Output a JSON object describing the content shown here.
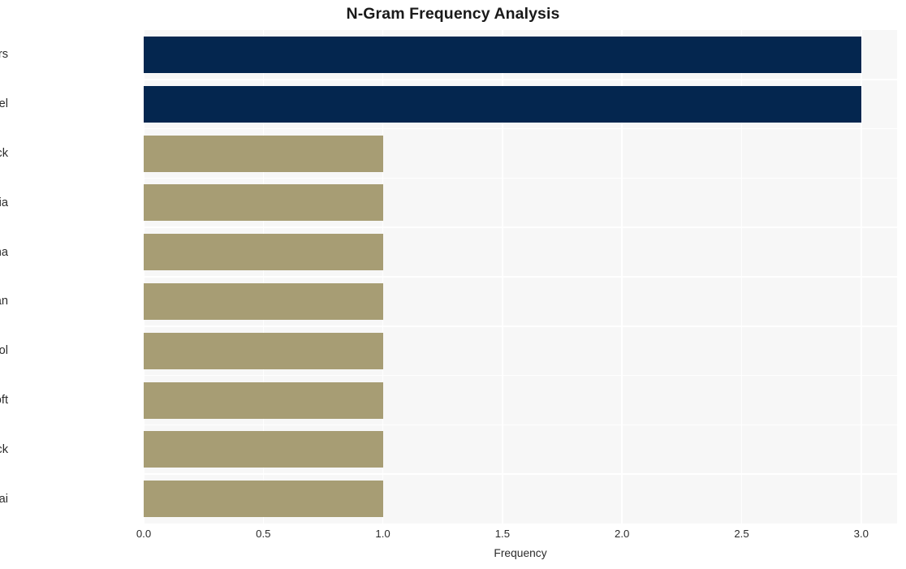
{
  "chart_data": {
    "type": "bar",
    "orientation": "horizontal",
    "title": "N-Gram Frequency Analysis",
    "xlabel": "Frequency",
    "ylabel": "",
    "categories": [
      "state back hackers",
      "large language model",
      "hash state back",
      "back hackers russia",
      "hackers russia china",
      "russia china iran",
      "china iran tool",
      "iran tool microsoft",
      "tool microsoft back",
      "microsoft back openai"
    ],
    "values": [
      3,
      3,
      1,
      1,
      1,
      1,
      1,
      1,
      1,
      1
    ],
    "bar_colors": [
      "#04264f",
      "#04264f",
      "#a79d74",
      "#a79d74",
      "#a79d74",
      "#a79d74",
      "#a79d74",
      "#a79d74",
      "#a79d74",
      "#a79d74"
    ],
    "xlim": [
      0,
      3.15
    ],
    "xticks": [
      0.0,
      0.5,
      1.0,
      1.5,
      2.0,
      2.5,
      3.0
    ],
    "xtick_labels": [
      "0.0",
      "0.5",
      "1.0",
      "1.5",
      "2.0",
      "2.5",
      "3.0"
    ],
    "grid": true,
    "grid_color": "#ffffff",
    "plot_background": "#f7f7f7",
    "figure_background": "#ffffff",
    "legend": null,
    "accent_color": "#04264f",
    "secondary_color": "#a79d74"
  }
}
